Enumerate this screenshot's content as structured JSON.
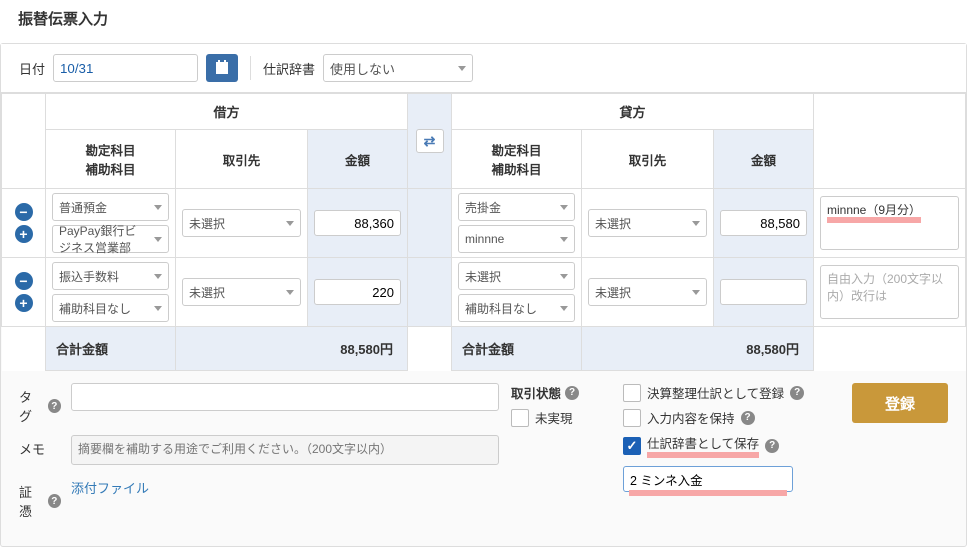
{
  "page_title": "振替伝票入力",
  "top": {
    "date_label": "日付",
    "date_value": "10/31",
    "dict_label": "仕訳辞書",
    "dict_value": "使用しない"
  },
  "headers": {
    "debit": "借方",
    "credit": "貸方",
    "account": "勘定科目",
    "sub_account": "補助科目",
    "partner": "取引先",
    "amount": "金額"
  },
  "rows": [
    {
      "debit": {
        "account": "普通預金",
        "sub_account": "PayPay銀行ビジネス営業部",
        "partner": "未選択",
        "amount": "88,360"
      },
      "credit": {
        "account": "売掛金",
        "sub_account": "minnne",
        "partner": "未選択",
        "amount": "88,580"
      },
      "note": "minnne（9月分）"
    },
    {
      "debit": {
        "account": "振込手数料",
        "sub_account": "補助科目なし",
        "partner": "未選択",
        "amount": "220"
      },
      "credit": {
        "account": "未選択",
        "sub_account": "補助科目なし",
        "partner": "未選択",
        "amount": ""
      },
      "note_placeholder": "自由入力（200文字以内）改行は"
    }
  ],
  "totals": {
    "label": "合計金額",
    "debit": "88,580円",
    "credit": "88,580円"
  },
  "bottom": {
    "tag_label": "タグ",
    "memo_label": "メモ",
    "memo_placeholder": "摘要欄を補助する用途でご利用ください。（200文字以内）",
    "evidence_label": "証憑",
    "evidence_link": "添付ファイル",
    "status_label": "取引状態",
    "unrealized": "未実現",
    "check1": "決算整理仕訳として登録",
    "check2": "入力内容を保持",
    "check3": "仕訳辞書として保存",
    "dict_input_value": "2 ミンネ入金",
    "register": "登録"
  }
}
